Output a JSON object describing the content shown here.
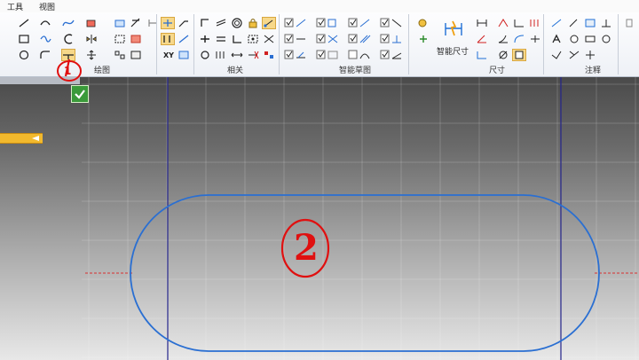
{
  "menu": {
    "tools": "工具",
    "view": "视图"
  },
  "ribbon": {
    "groups": {
      "draw": "绘图",
      "relation": "相关",
      "smart_sketch": "智能草图",
      "dimension": "尺寸",
      "annotation": "注释"
    },
    "xy_label": "XY",
    "smart_dimension_label": "智能尺寸"
  },
  "annotations": {
    "marker_1": "1",
    "marker_2": "2"
  },
  "colors": {
    "accent": "#1f6fd6",
    "sketch_line": "#2a6fd2",
    "datum_line": "#24248a",
    "marker": "#e01010",
    "highlight": "#f7d88a"
  }
}
